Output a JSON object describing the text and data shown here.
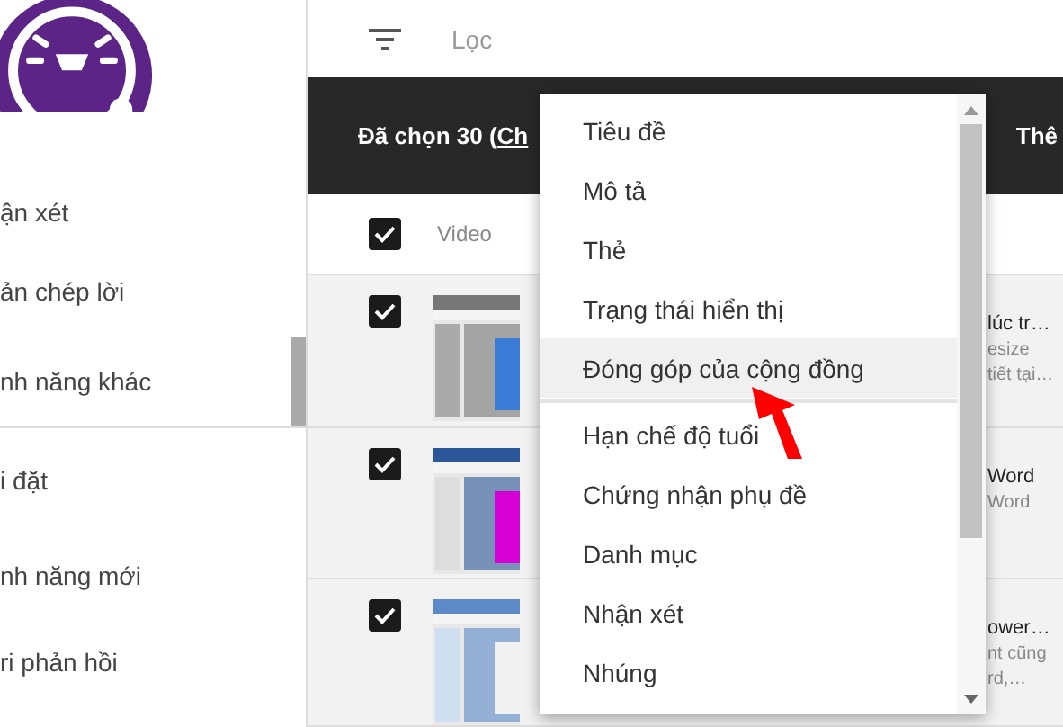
{
  "sidebar": {
    "items": [
      {
        "label": "ận xét"
      },
      {
        "label": "ản chép lời"
      },
      {
        "label": "nh năng khác"
      },
      {
        "label": "i đặt"
      },
      {
        "label": "nh năng mới"
      },
      {
        "label": "ri phản hồi"
      }
    ]
  },
  "toolbar": {
    "filter_label": "Lọc"
  },
  "selection_bar": {
    "text": "Đã chọn 30 (",
    "link": "Ch",
    "action": "Thê"
  },
  "table": {
    "header": {
      "checked": true,
      "column": "Video"
    },
    "rows": [
      {
        "checked": true,
        "title": "lúc tr…",
        "lines": [
          "esize",
          "tiết tại…"
        ]
      },
      {
        "checked": true,
        "title": "Word",
        "lines": [
          "Word"
        ]
      },
      {
        "checked": true,
        "title": "ower…",
        "lines": [
          "nt cũng",
          "rd,…"
        ]
      }
    ]
  },
  "menu": {
    "items": [
      {
        "kind": "option",
        "label": "Tiêu đề",
        "selected": false
      },
      {
        "kind": "option",
        "label": "Mô tả",
        "selected": false
      },
      {
        "kind": "option",
        "label": "Thẻ",
        "selected": false
      },
      {
        "kind": "option",
        "label": "Trạng thái hiển thị",
        "selected": false
      },
      {
        "kind": "option",
        "label": "Đóng góp của cộng đồng",
        "selected": true
      },
      {
        "kind": "divider"
      },
      {
        "kind": "option",
        "label": "Hạn chế độ tuổi",
        "selected": false
      },
      {
        "kind": "option",
        "label": "Chứng nhận phụ đề",
        "selected": false
      },
      {
        "kind": "option",
        "label": "Danh mục",
        "selected": false
      },
      {
        "kind": "option",
        "label": "Nhận xét",
        "selected": false
      },
      {
        "kind": "option",
        "label": "Nhúng",
        "selected": false
      }
    ]
  }
}
